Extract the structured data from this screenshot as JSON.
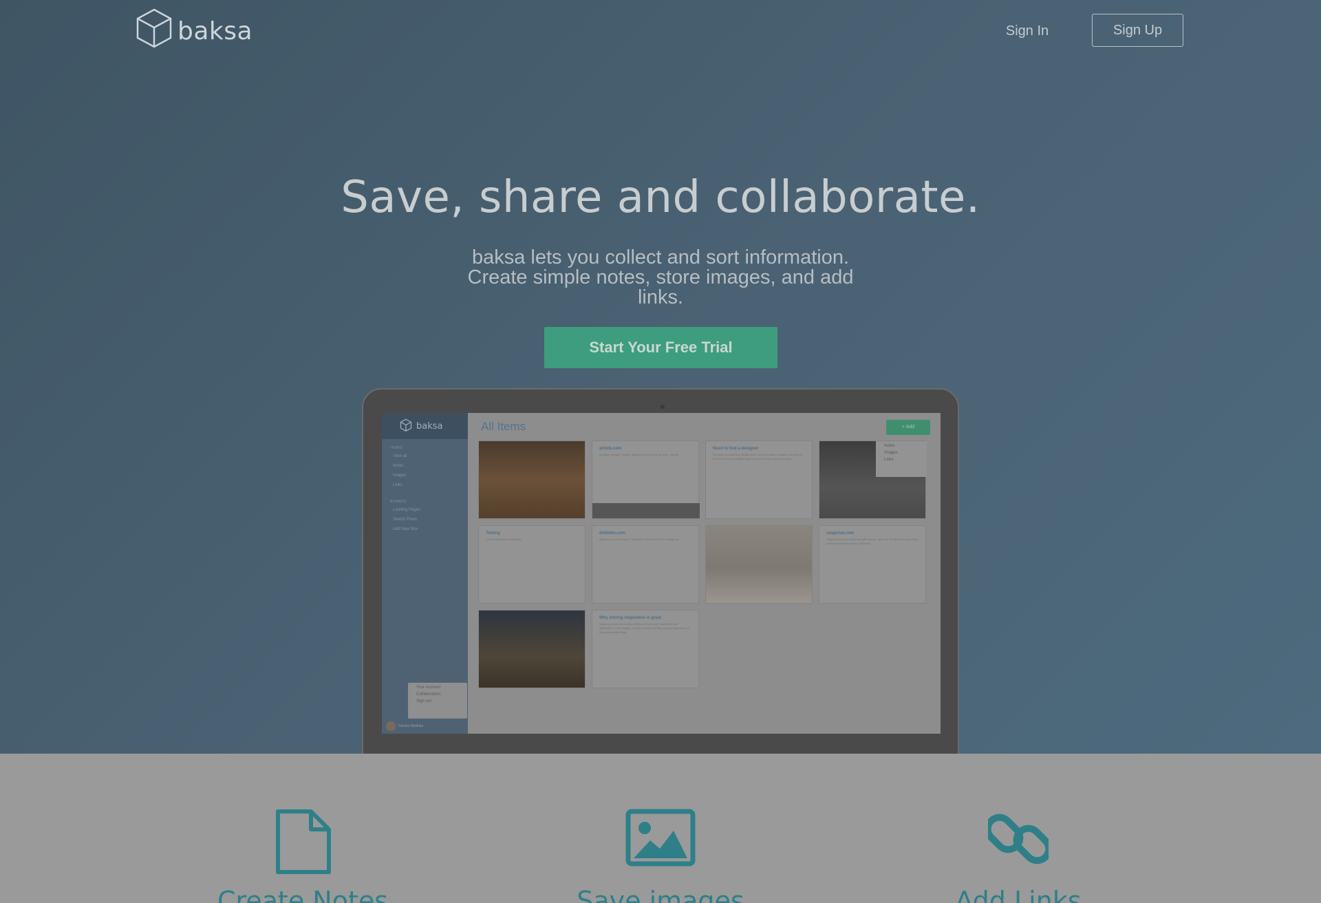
{
  "header": {
    "brand": "baksa",
    "sign_in": "Sign In",
    "sign_up": "Sign Up"
  },
  "hero": {
    "headline": "Save, share and collaborate.",
    "subtext": "baksa lets you collect and sort information. Create simple notes, store images, and add links.",
    "cta": "Start Your Free Trial"
  },
  "app_preview": {
    "brand": "baksa",
    "title": "All Items",
    "add_button": "+ Add",
    "sidebar_sections": [
      "ITEMS",
      "BOARDS"
    ],
    "sidebar_items": [
      "View all",
      "Notes",
      "Images",
      "Links"
    ],
    "boards": [
      "Landing Pages",
      "Sketch Plans",
      "Add New Box"
    ],
    "user_menu": [
      "Your Account",
      "Collaborators",
      "Sign out"
    ],
    "user_name": "Harsha Makkala",
    "filter_menu": [
      "Notes",
      "Images",
      "Links"
    ],
    "cards": [
      {
        "title": "airbnb.com",
        "body": "Vacation Rentals, Homes, Apartments & Rooms for Rent - Airbnb"
      },
      {
        "title": "Need to find a designer",
        "body": "We have a one-person design team, but are ready to expand. We need to look for a second designer right now so we can continue to grow."
      },
      {
        "title": "Testing",
        "body": "I love watermelon smoothies!"
      },
      {
        "title": "dribbble.com",
        "body": "What are you working on? Dribbble is show and tell for designers."
      },
      {
        "title": "snapchat.com",
        "body": "Snapchat lets you easily talk with friends, view Live Stories from around the world, and explore news in Discover."
      },
      {
        "title": "Why storing inspiration is great",
        "body": "Baksa is a new tool to help collect and store your inspiration and information. From images, to links, to notes the files you can keep track of all your favorite things."
      }
    ]
  },
  "features": [
    {
      "label": "Create Notes",
      "icon": "document-icon"
    },
    {
      "label": "Save images",
      "icon": "image-icon"
    },
    {
      "label": "Add Links",
      "icon": "link-icon"
    }
  ],
  "colors": {
    "hero_bg": "#4a6273",
    "cta": "#3f9d7f",
    "feature_accent": "#2f7f88"
  }
}
